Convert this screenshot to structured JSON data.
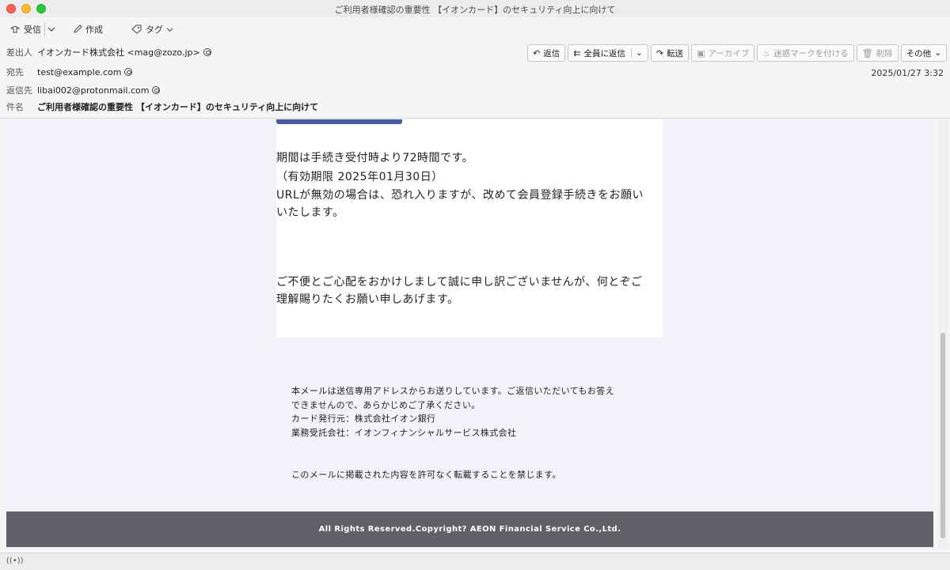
{
  "window": {
    "title": "ご利用者様確認の重要性 【イオンカード】のセキュリティ向上に向けて"
  },
  "toolbar": {
    "receive": "受信",
    "compose": "作成",
    "tag": "タグ"
  },
  "header": {
    "from_label": "差出人",
    "from": "イオンカード株式会社 <mag@zozo.jp>",
    "to_label": "宛先",
    "to": "test@example.com",
    "replyto_label": "返信先",
    "replyto": "libai002@protonmail.com",
    "subject_label": "件名",
    "subject": "ご利用者様確認の重要性 【イオンカード】のセキュリティ向上に向けて",
    "date": "2025/01/27 3:32"
  },
  "actions": {
    "reply": "返信",
    "reply_all": "全員に返信",
    "forward": "転送",
    "archive": "アーカイブ",
    "junk": "迷惑マークを付ける",
    "delete": "削除",
    "other": "その他"
  },
  "body": {
    "line1": "期間は手続き受付時より72時間です。",
    "line2": "（有効期限 2025年01月30日）",
    "line3a": "URLが無効の場合は、恐れ入りますが、改めて会員登録手続きをお願い",
    "line3b": "いたします。",
    "line4a": "ご不便とご心配をおかけしまして誠に申し訳ございませんが、何とぞご",
    "line4b": "理解賜りたくお願い申しあげます。"
  },
  "footer": {
    "l1": "本メールは送信専用アドレスからお送りしています。ご返信いただいてもお答え",
    "l2": "できませんので、あらかじめご了承ください。",
    "l3": "カード発行元：株式会社イオン銀行",
    "l4": "業務受託会社：イオンフィナンシャルサービス株式会社",
    "l5": "このメールに掲載された内容を許可なく転載することを禁じます。",
    "copyright": "All Rights Reserved.Copyright? AEON Financial Service Co.,Ltd."
  }
}
